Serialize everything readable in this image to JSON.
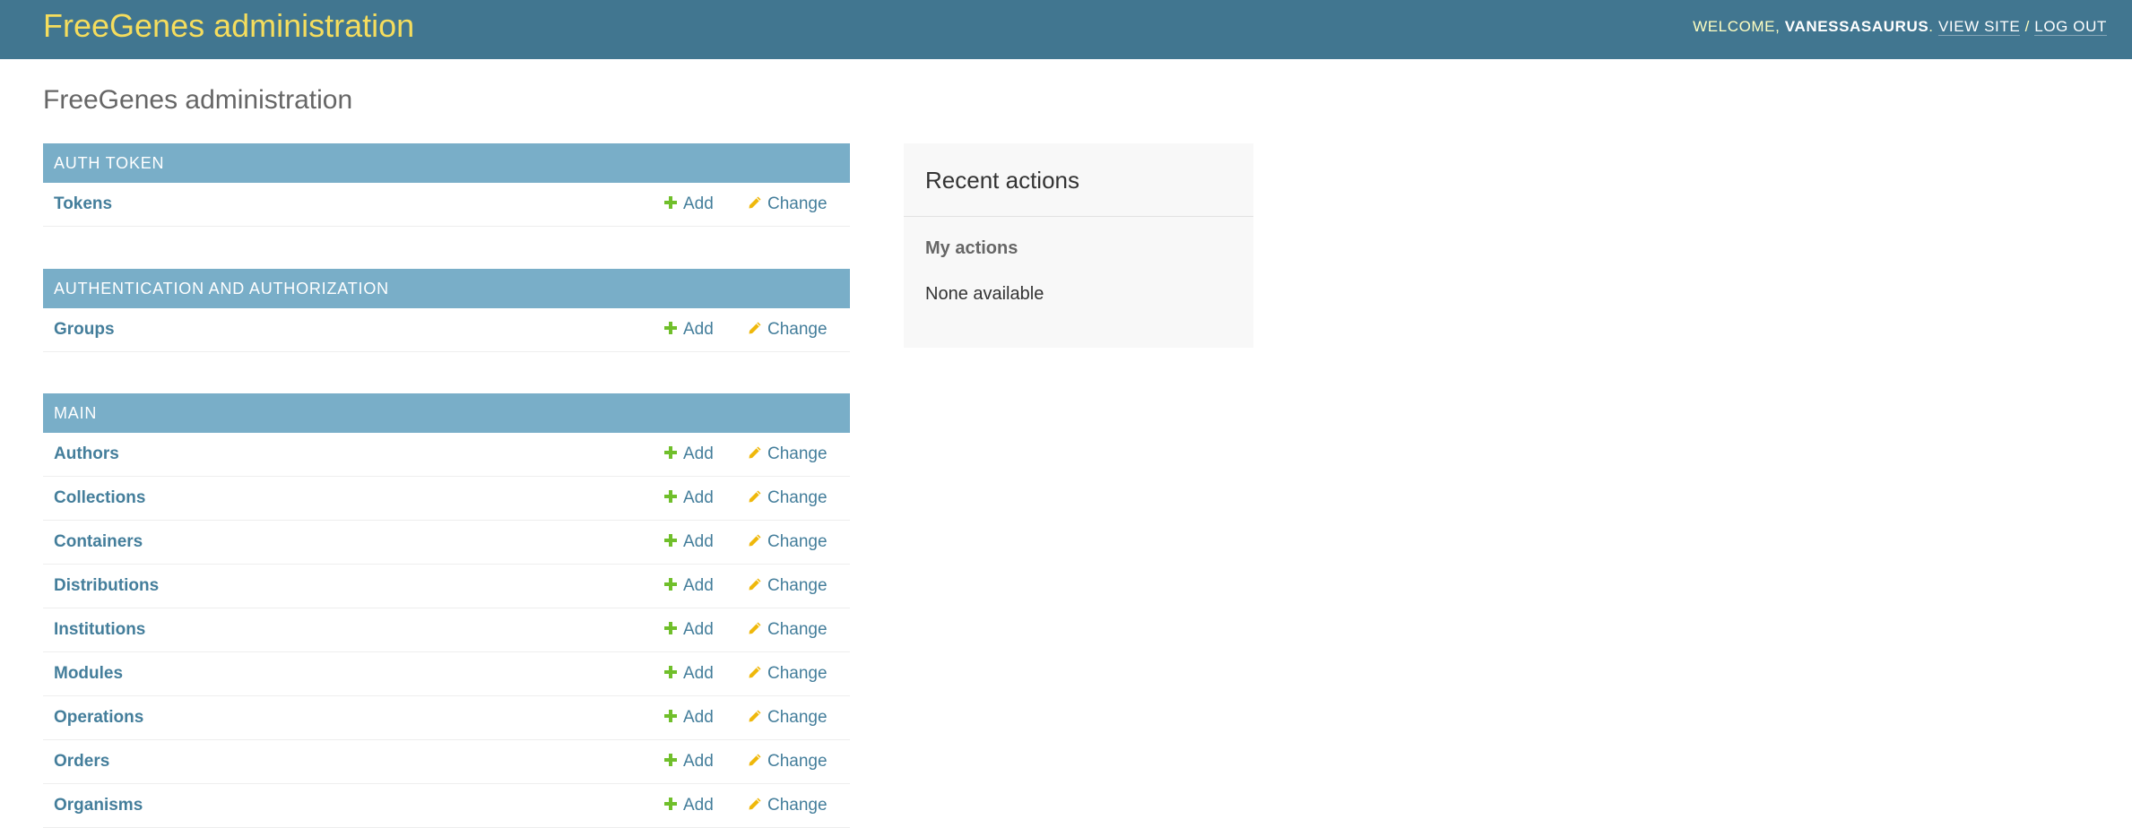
{
  "header": {
    "site_name": "FreeGenes administration",
    "welcome_prefix": "Welcome, ",
    "username": "vanessasaurus",
    "separator_dot": ". ",
    "view_site": "View site",
    "slash": " / ",
    "log_out": "Log out",
    "background_color": "#417690",
    "branding_color": "#f5dd5d"
  },
  "page": {
    "title": "FreeGenes administration"
  },
  "labels": {
    "add": "Add",
    "change": "Change"
  },
  "modules": [
    {
      "caption": "Auth Token",
      "models": [
        "Tokens"
      ]
    },
    {
      "caption": "Authentication and Authorization",
      "models": [
        "Groups"
      ]
    },
    {
      "caption": "Main",
      "models": [
        "Authors",
        "Collections",
        "Containers",
        "Distributions",
        "Institutions",
        "Modules",
        "Operations",
        "Orders",
        "Organisms"
      ]
    }
  ],
  "recent_actions": {
    "title": "Recent actions",
    "subtitle": "My actions",
    "empty_text": "None available"
  },
  "colors": {
    "caption_bg": "#79aec8",
    "link": "#447e9b",
    "add_icon": "#70bf2b",
    "change_icon": "#efb80b"
  }
}
